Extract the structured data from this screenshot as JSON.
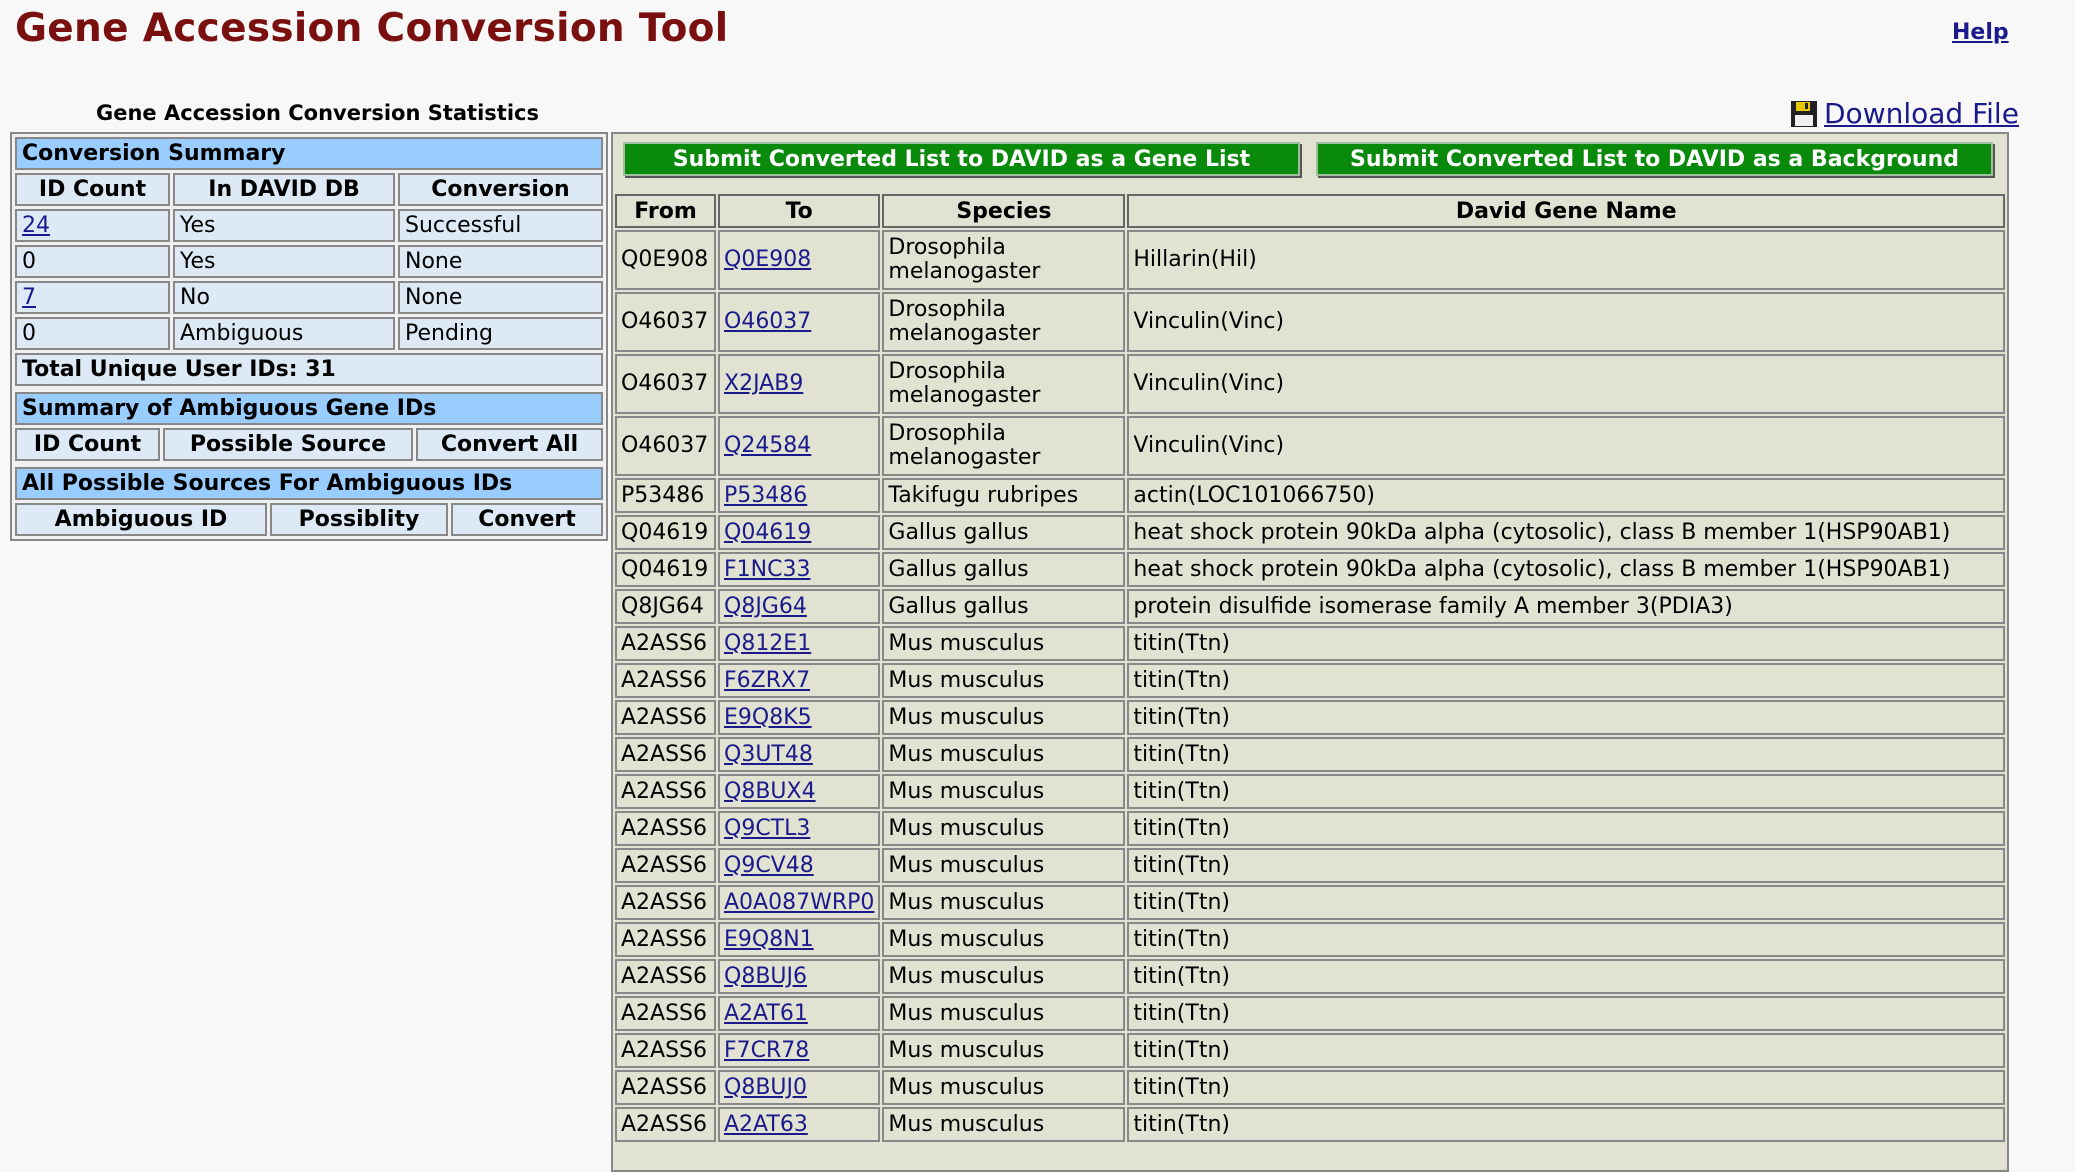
{
  "header": {
    "title": "Gene Accession Conversion Tool",
    "help": "Help"
  },
  "stats_title": "Gene Accession Conversion Statistics",
  "download_label": "Download File",
  "conversion_summary": {
    "heading": "Conversion Summary",
    "columns": [
      "ID Count",
      "In DAVID DB",
      "Conversion"
    ],
    "rows": [
      {
        "count": "24",
        "link": true,
        "in_db": "Yes",
        "conversion": "Successful"
      },
      {
        "count": "0",
        "link": false,
        "in_db": "Yes",
        "conversion": "None"
      },
      {
        "count": "7",
        "link": true,
        "in_db": "No",
        "conversion": "None"
      },
      {
        "count": "0",
        "link": false,
        "in_db": "Ambiguous",
        "conversion": "Pending"
      }
    ],
    "total": "Total Unique User IDs: 31"
  },
  "ambiguous_summary": {
    "heading": "Summary of Ambiguous Gene IDs",
    "columns": [
      "ID Count",
      "Possible Source",
      "Convert All"
    ]
  },
  "ambiguous_sources": {
    "heading": "All Possible Sources For Ambiguous IDs",
    "columns": [
      "Ambiguous ID",
      "Possiblity",
      "Convert"
    ]
  },
  "buttons": {
    "gene_list": "Submit Converted List to DAVID as a Gene List",
    "background": "Submit Converted List to DAVID as a Background"
  },
  "results": {
    "columns": [
      "From",
      "To",
      "Species",
      "David Gene Name"
    ],
    "rows": [
      {
        "from": "Q0E908",
        "to": "Q0E908",
        "species": "Drosophila melanogaster",
        "gene": "Hillarin(Hil)"
      },
      {
        "from": "O46037",
        "to": "O46037",
        "species": "Drosophila melanogaster",
        "gene": "Vinculin(Vinc)"
      },
      {
        "from": "O46037",
        "to": "X2JAB9",
        "species": "Drosophila melanogaster",
        "gene": "Vinculin(Vinc)"
      },
      {
        "from": "O46037",
        "to": "Q24584",
        "species": "Drosophila melanogaster",
        "gene": "Vinculin(Vinc)"
      },
      {
        "from": "P53486",
        "to": "P53486",
        "species": "Takifugu rubripes",
        "gene": "actin(LOC101066750)"
      },
      {
        "from": "Q04619",
        "to": "Q04619",
        "species": "Gallus gallus",
        "gene": "heat shock protein 90kDa alpha (cytosolic), class B member 1(HSP90AB1)"
      },
      {
        "from": "Q04619",
        "to": "F1NC33",
        "species": "Gallus gallus",
        "gene": "heat shock protein 90kDa alpha (cytosolic), class B member 1(HSP90AB1)"
      },
      {
        "from": "Q8JG64",
        "to": "Q8JG64",
        "species": "Gallus gallus",
        "gene": "protein disulfide isomerase family A member 3(PDIA3)"
      },
      {
        "from": "A2ASS6",
        "to": "Q812E1",
        "species": "Mus musculus",
        "gene": "titin(Ttn)"
      },
      {
        "from": "A2ASS6",
        "to": "F6ZRX7",
        "species": "Mus musculus",
        "gene": "titin(Ttn)"
      },
      {
        "from": "A2ASS6",
        "to": "E9Q8K5",
        "species": "Mus musculus",
        "gene": "titin(Ttn)"
      },
      {
        "from": "A2ASS6",
        "to": "Q3UT48",
        "species": "Mus musculus",
        "gene": "titin(Ttn)"
      },
      {
        "from": "A2ASS6",
        "to": "Q8BUX4",
        "species": "Mus musculus",
        "gene": "titin(Ttn)"
      },
      {
        "from": "A2ASS6",
        "to": "Q9CTL3",
        "species": "Mus musculus",
        "gene": "titin(Ttn)"
      },
      {
        "from": "A2ASS6",
        "to": "Q9CV48",
        "species": "Mus musculus",
        "gene": "titin(Ttn)"
      },
      {
        "from": "A2ASS6",
        "to": "A0A087WRP0",
        "species": "Mus musculus",
        "gene": "titin(Ttn)"
      },
      {
        "from": "A2ASS6",
        "to": "E9Q8N1",
        "species": "Mus musculus",
        "gene": "titin(Ttn)"
      },
      {
        "from": "A2ASS6",
        "to": "Q8BUJ6",
        "species": "Mus musculus",
        "gene": "titin(Ttn)"
      },
      {
        "from": "A2ASS6",
        "to": "A2AT61",
        "species": "Mus musculus",
        "gene": "titin(Ttn)"
      },
      {
        "from": "A2ASS6",
        "to": "F7CR78",
        "species": "Mus musculus",
        "gene": "titin(Ttn)"
      },
      {
        "from": "A2ASS6",
        "to": "Q8BUJ0",
        "species": "Mus musculus",
        "gene": "titin(Ttn)"
      },
      {
        "from": "A2ASS6",
        "to": "A2AT63",
        "species": "Mus musculus",
        "gene": "titin(Ttn)"
      }
    ]
  }
}
